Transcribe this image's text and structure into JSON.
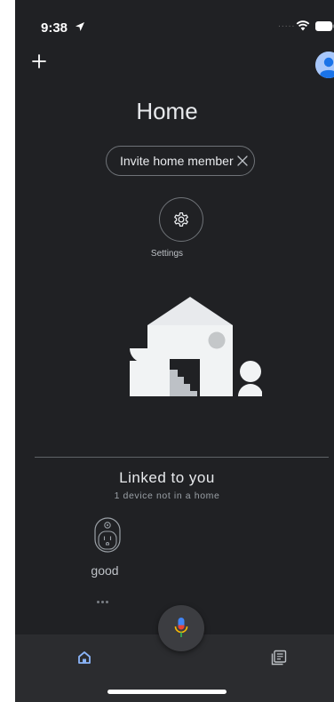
{
  "status_bar": {
    "time": "9:38",
    "signal": "....."
  },
  "header": {
    "title": "Home"
  },
  "invite": {
    "label": "Invite home member"
  },
  "settings": {
    "label": "Settings"
  },
  "linked": {
    "title": "Linked to you",
    "subtitle": "1 device not in a home",
    "devices": [
      {
        "name": "good",
        "icon": "smart-plug-icon"
      }
    ]
  },
  "nav": {
    "items": [
      {
        "icon": "home-icon",
        "active": true
      },
      {
        "icon": "feed-icon",
        "active": false
      }
    ]
  },
  "colors": {
    "background": "#202124",
    "accent": "#8ab4f8",
    "mic_red": "#ea4335",
    "mic_blue": "#4285f4",
    "mic_yellow": "#fbbc04",
    "mic_green": "#34a853"
  },
  "icons": {
    "add": "plus-icon",
    "avatar": "account-avatar-icon",
    "chip_close": "close-icon",
    "settings": "gear-icon",
    "mic": "mic-icon"
  }
}
